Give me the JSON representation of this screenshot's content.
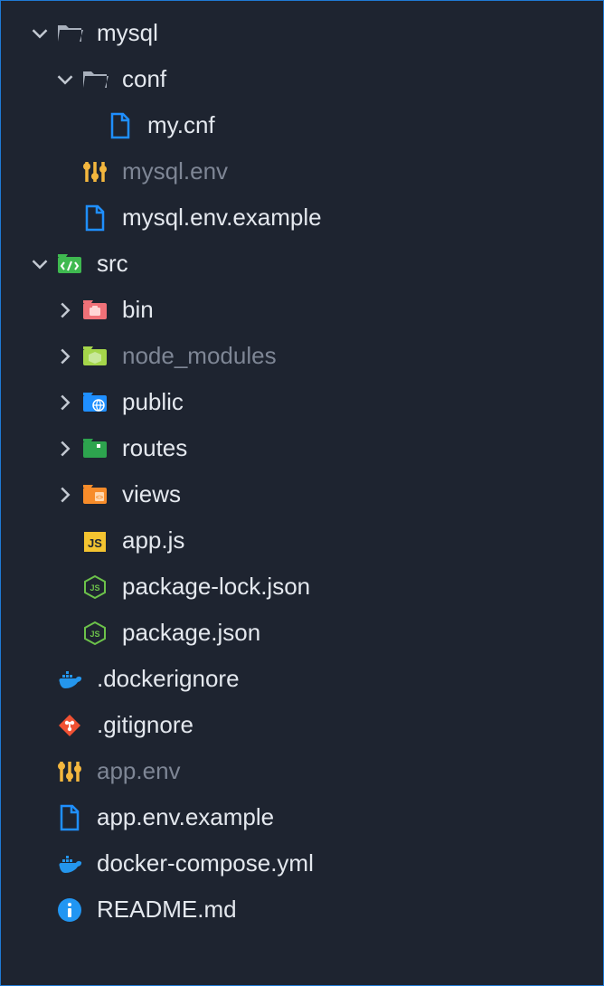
{
  "tree": [
    {
      "id": "mysql",
      "label": "mysql",
      "indent": 1,
      "expanded": true,
      "kind": "folder",
      "dimmed": false
    },
    {
      "id": "conf",
      "label": "conf",
      "indent": 2,
      "expanded": true,
      "kind": "folder",
      "dimmed": false
    },
    {
      "id": "mycnf",
      "label": "my.cnf",
      "indent": 3,
      "expanded": null,
      "kind": "file-generic",
      "dimmed": false
    },
    {
      "id": "menv",
      "label": "mysql.env",
      "indent": 2,
      "expanded": null,
      "kind": "env",
      "dimmed": true
    },
    {
      "id": "menvex",
      "label": "mysql.env.example",
      "indent": 2,
      "expanded": null,
      "kind": "file-generic",
      "dimmed": false
    },
    {
      "id": "src",
      "label": "src",
      "indent": 1,
      "expanded": true,
      "kind": "folder-src",
      "dimmed": false
    },
    {
      "id": "bin",
      "label": "bin",
      "indent": 2,
      "expanded": false,
      "kind": "folder-bin",
      "dimmed": false
    },
    {
      "id": "nm",
      "label": "node_modules",
      "indent": 2,
      "expanded": false,
      "kind": "folder-nm",
      "dimmed": true
    },
    {
      "id": "public",
      "label": "public",
      "indent": 2,
      "expanded": false,
      "kind": "folder-public",
      "dimmed": false
    },
    {
      "id": "routes",
      "label": "routes",
      "indent": 2,
      "expanded": false,
      "kind": "folder-routes",
      "dimmed": false
    },
    {
      "id": "views",
      "label": "views",
      "indent": 2,
      "expanded": false,
      "kind": "folder-views",
      "dimmed": false
    },
    {
      "id": "appjs",
      "label": "app.js",
      "indent": 2,
      "expanded": null,
      "kind": "js",
      "dimmed": false
    },
    {
      "id": "plock",
      "label": "package-lock.json",
      "indent": 2,
      "expanded": null,
      "kind": "node",
      "dimmed": false
    },
    {
      "id": "pjson",
      "label": "package.json",
      "indent": 2,
      "expanded": null,
      "kind": "node",
      "dimmed": false
    },
    {
      "id": "dign",
      "label": ".dockerignore",
      "indent": 1,
      "expanded": null,
      "kind": "docker",
      "dimmed": false
    },
    {
      "id": "gign",
      "label": ".gitignore",
      "indent": 1,
      "expanded": null,
      "kind": "git",
      "dimmed": false
    },
    {
      "id": "appenv",
      "label": "app.env",
      "indent": 1,
      "expanded": null,
      "kind": "env",
      "dimmed": true
    },
    {
      "id": "appenvex",
      "label": "app.env.example",
      "indent": 1,
      "expanded": null,
      "kind": "file-generic",
      "dimmed": false
    },
    {
      "id": "dcomp",
      "label": "docker-compose.yml",
      "indent": 1,
      "expanded": null,
      "kind": "docker",
      "dimmed": false
    },
    {
      "id": "readme",
      "label": "README.md",
      "indent": 1,
      "expanded": null,
      "kind": "info",
      "dimmed": false
    }
  ]
}
